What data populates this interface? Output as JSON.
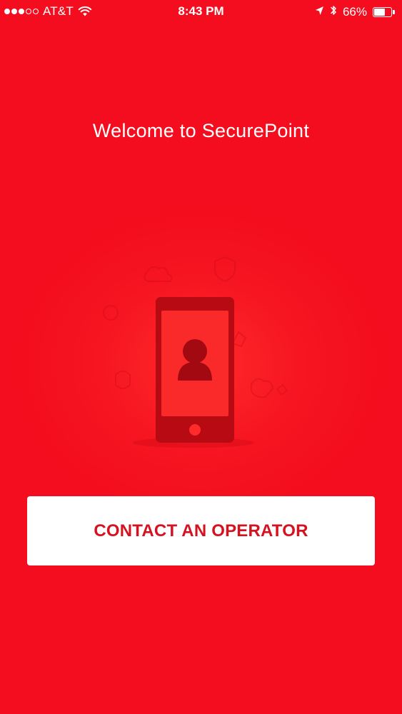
{
  "status_bar": {
    "carrier": "AT&T",
    "signal_bars_filled": 3,
    "signal_bars_total": 5,
    "time": "8:43 PM",
    "battery_percent": "66%",
    "battery_level": 0.66
  },
  "welcome": {
    "title": "Welcome to SecurePoint"
  },
  "illustration": {
    "icons": [
      "phone-icon",
      "user-avatar-icon",
      "faint-background-icons"
    ]
  },
  "actions": {
    "contact_label": "CONTACT AN OPERATOR"
  },
  "colors": {
    "background": "#f50e1f",
    "button_background": "#ffffff",
    "button_text": "#d41220",
    "phone_body": "#b80a13",
    "phone_screen": "#fa2a2a"
  }
}
